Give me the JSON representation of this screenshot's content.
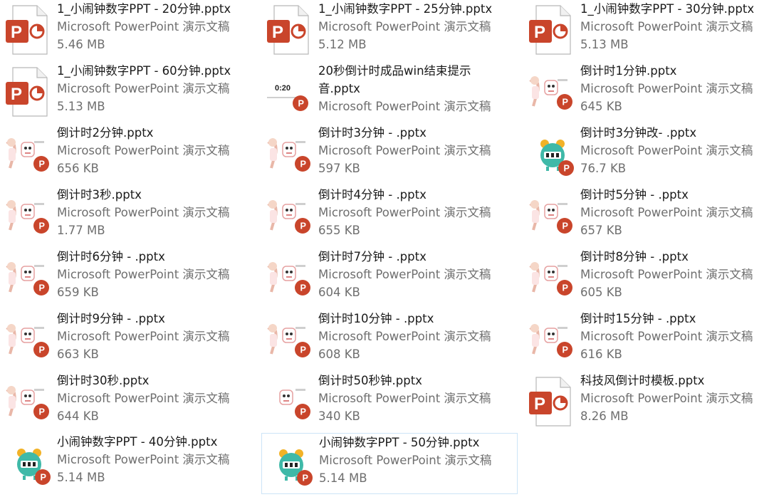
{
  "colors": {
    "ppt_accent": "#c9452b",
    "selection_border": "#cce4f7",
    "text_primary": "#1a1a1a",
    "text_secondary": "#6f6f6f"
  },
  "files": [
    {
      "name": "1_小闹钟数字PPT - 20分钟.pptx",
      "type": "Microsoft PowerPoint 演示文稿",
      "size": "5.46 MB",
      "icon": "ppt-file-icon"
    },
    {
      "name": "1_小闹钟数字PPT - 25分钟.pptx",
      "type": "Microsoft PowerPoint 演示文稿",
      "size": "5.12 MB",
      "icon": "ppt-file-icon"
    },
    {
      "name": "1_小闹钟数字PPT - 30分钟.pptx",
      "type": "Microsoft PowerPoint 演示文稿",
      "size": "5.13 MB",
      "icon": "ppt-file-icon"
    },
    {
      "name": "1_小闹钟数字PPT - 60分钟.pptx",
      "type": "Microsoft PowerPoint 演示文稿",
      "size": "5.13 MB",
      "icon": "ppt-file-icon"
    },
    {
      "name": "20秒倒计时成品win结束提示音.pptx",
      "type": "Microsoft PowerPoint 演示文稿",
      "size": "",
      "icon": "timer-thumbnail-icon",
      "thumb_text": "0:20",
      "wrap": true
    },
    {
      "name": "倒计时1分钟.pptx",
      "type": "Microsoft PowerPoint 演示文稿",
      "size": "645 KB",
      "icon": "cartoon-thumbnail-icon"
    },
    {
      "name": "倒计时2分钟.pptx",
      "type": "Microsoft PowerPoint 演示文稿",
      "size": "656 KB",
      "icon": "cartoon-thumbnail-icon"
    },
    {
      "name": "倒计时3分钟 - .pptx",
      "type": "Microsoft PowerPoint 演示文稿",
      "size": "597 KB",
      "icon": "cartoon-thumbnail-icon"
    },
    {
      "name": "倒计时3分钟改- .pptx",
      "type": "Microsoft PowerPoint 演示文稿",
      "size": "76.7 KB",
      "icon": "alarm-clock-thumbnail-icon"
    },
    {
      "name": "倒计时3秒.pptx",
      "type": "Microsoft PowerPoint 演示文稿",
      "size": "1.77 MB",
      "icon": "cartoon-thumbnail-icon"
    },
    {
      "name": "倒计时4分钟 - .pptx",
      "type": "Microsoft PowerPoint 演示文稿",
      "size": "655 KB",
      "icon": "cartoon-thumbnail-icon"
    },
    {
      "name": "倒计时5分钟 - .pptx",
      "type": "Microsoft PowerPoint 演示文稿",
      "size": "657 KB",
      "icon": "cartoon-thumbnail-icon"
    },
    {
      "name": "倒计时6分钟 - .pptx",
      "type": "Microsoft PowerPoint 演示文稿",
      "size": "659 KB",
      "icon": "cartoon-thumbnail-icon"
    },
    {
      "name": "倒计时7分钟 -  .pptx",
      "type": "Microsoft PowerPoint 演示文稿",
      "size": "604 KB",
      "icon": "cartoon-thumbnail-icon"
    },
    {
      "name": "倒计时8分钟 - .pptx",
      "type": "Microsoft PowerPoint 演示文稿",
      "size": "605 KB",
      "icon": "cartoon-thumbnail-icon"
    },
    {
      "name": "倒计时9分钟 - .pptx",
      "type": "Microsoft PowerPoint 演示文稿",
      "size": "663 KB",
      "icon": "cartoon-thumbnail-icon"
    },
    {
      "name": "倒计时10分钟 -  .pptx",
      "type": "Microsoft PowerPoint 演示文稿",
      "size": "608 KB",
      "icon": "cartoon-thumbnail-icon"
    },
    {
      "name": "倒计时15分钟 -  .pptx",
      "type": "Microsoft PowerPoint 演示文稿",
      "size": "616 KB",
      "icon": "cartoon-thumbnail-icon"
    },
    {
      "name": "倒计时30秒.pptx",
      "type": "Microsoft PowerPoint 演示文稿",
      "size": "644 KB",
      "icon": "cartoon-thumbnail-icon"
    },
    {
      "name": "倒计时50秒钟.pptx",
      "type": "Microsoft PowerPoint 演示文稿",
      "size": "340 KB",
      "icon": "cartoon-small-thumbnail-icon"
    },
    {
      "name": "科技风倒计时模板.pptx",
      "type": "Microsoft PowerPoint 演示文稿",
      "size": "8.26 MB",
      "icon": "ppt-file-icon"
    },
    {
      "name": "小闹钟数字PPT - 40分钟.pptx",
      "type": "Microsoft PowerPoint 演示文稿",
      "size": "5.14 MB",
      "icon": "alarm-clock-thumbnail-icon"
    },
    {
      "name": "小闹钟数字PPT - 50分钟.pptx",
      "type": "Microsoft PowerPoint 演示文稿",
      "size": "5.14 MB",
      "icon": "alarm-clock-thumbnail-icon",
      "selected": true
    }
  ]
}
